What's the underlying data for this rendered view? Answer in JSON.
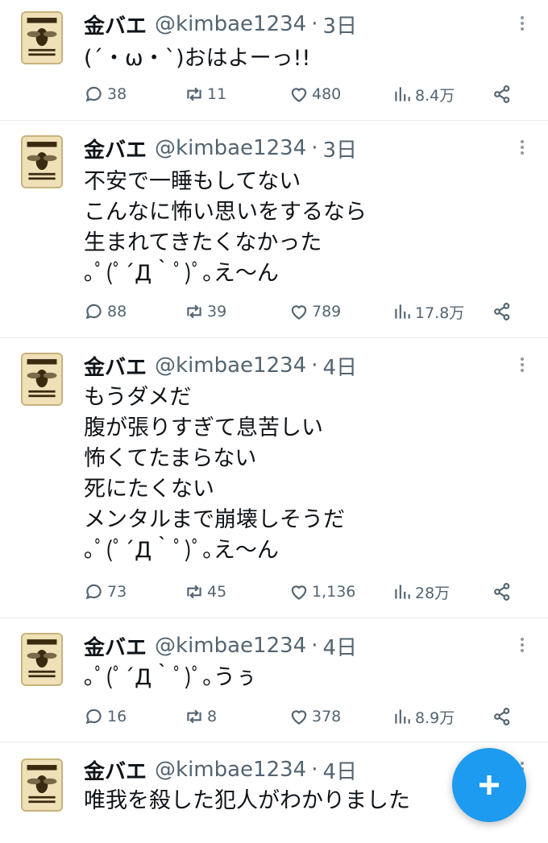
{
  "tweets": [
    {
      "name": "金バエ",
      "handle": "@kimbae1234",
      "date": "3日",
      "lines": [
        "(´・ω・`)おはよーっ!!"
      ],
      "replies": "38",
      "retweets": "11",
      "likes": "480",
      "views": "8.4万"
    },
    {
      "name": "金バエ",
      "handle": "@kimbae1234",
      "date": "3日",
      "lines": [
        "不安で一睡もしてない",
        "こんなに怖い思いをするなら",
        "生まれてきたくなかった",
        "｡ﾟ(ﾟ´Д｀ﾟ)ﾟ｡え〜ん"
      ],
      "replies": "88",
      "retweets": "39",
      "likes": "789",
      "views": "17.8万"
    },
    {
      "name": "金バエ",
      "handle": "@kimbae1234",
      "date": "4日",
      "lines": [
        "もうダメだ",
        "腹が張りすぎて息苦しい",
        "怖くてたまらない",
        "死にたくない",
        "メンタルまで崩壊しそうだ",
        "｡ﾟ(ﾟ´Д｀ﾟ)ﾟ｡え〜ん"
      ],
      "replies": "73",
      "retweets": "45",
      "likes": "1,136",
      "views": "28万"
    },
    {
      "name": "金バエ",
      "handle": "@kimbae1234",
      "date": "4日",
      "lines": [
        "｡ﾟ(ﾟ´Д｀ﾟ)ﾟ｡うぅ"
      ],
      "replies": "16",
      "retweets": "8",
      "likes": "378",
      "views": "8.9万"
    },
    {
      "name": "金バエ",
      "handle": "@kimbae1234",
      "date": "4日",
      "lines": [
        "唯我を殺した犯人がわかりました"
      ]
    }
  ],
  "icons": {
    "reply": "reply-icon",
    "retweet": "retweet-icon",
    "like": "heart-icon",
    "views": "views-chart-icon",
    "share": "share-icon",
    "more": "more-dots-icon",
    "compose": "plus-icon"
  },
  "colors": {
    "accent": "#1d9bf0",
    "text": "#0f1419",
    "muted": "#536471",
    "divider": "#e6ecf0"
  }
}
